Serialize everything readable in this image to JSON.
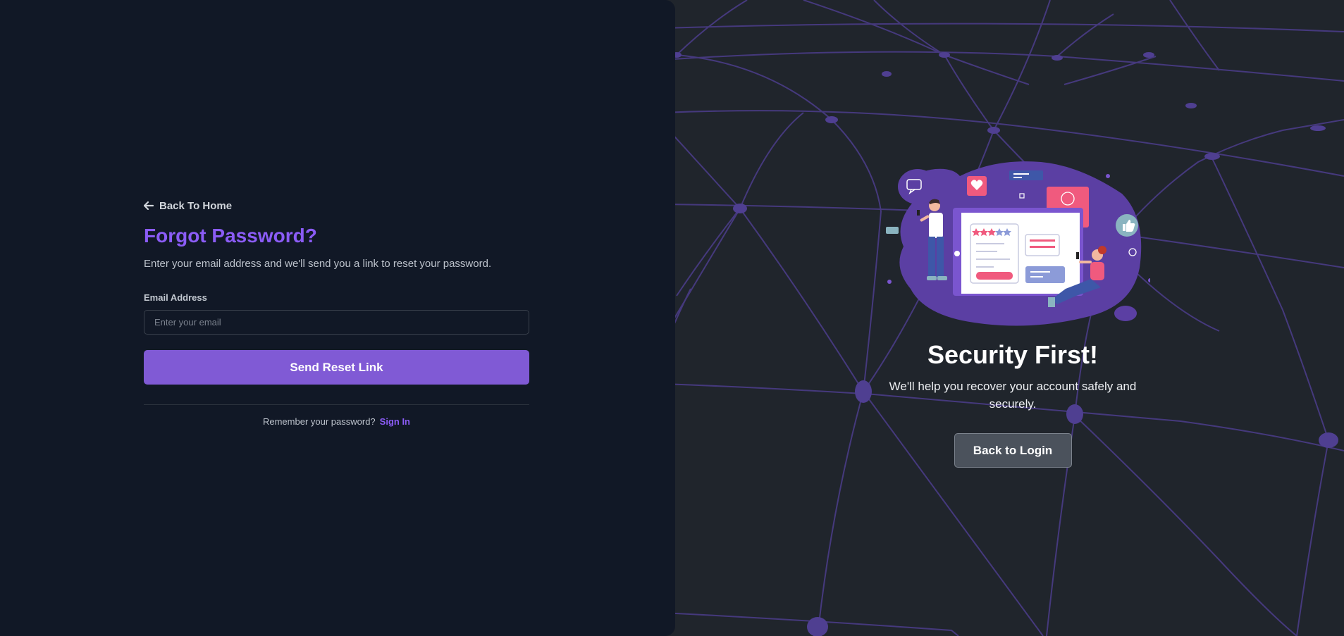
{
  "left": {
    "back_home_label": "Back To Home",
    "title": "Forgot Password?",
    "subtitle": "Enter your email address and we'll send you a link to reset your password.",
    "email_label": "Email Address",
    "email_placeholder": "Enter your email",
    "email_value": "",
    "submit_label": "Send Reset Link",
    "remember_text": "Remember your password?",
    "signin_label": "Sign In"
  },
  "right": {
    "title": "Security First!",
    "subtitle": "We'll help you recover your account safely and securely.",
    "back_login_label": "Back to Login"
  },
  "colors": {
    "accent": "#805ad5",
    "accent_text": "#8b5cf6",
    "left_bg": "#111826",
    "right_bg": "#20252c",
    "mesh_line": "#4c3d8a"
  },
  "icons": {
    "back": "arrow-left-icon"
  }
}
